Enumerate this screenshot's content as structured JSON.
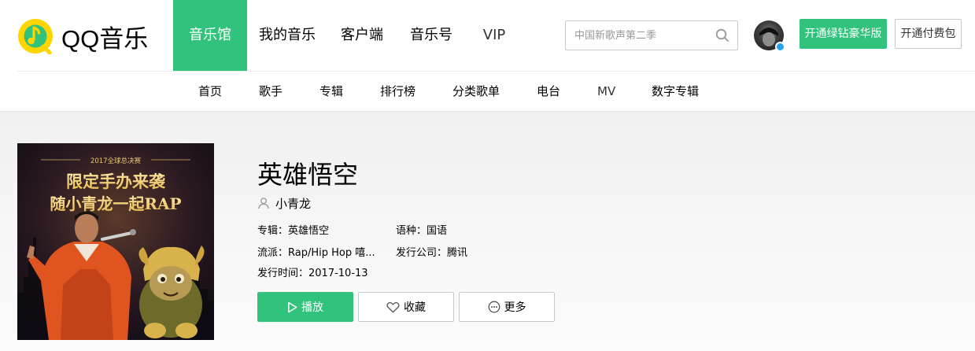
{
  "header": {
    "logo_text": "QQ音乐",
    "nav": [
      {
        "label": "音乐馆",
        "active": true
      },
      {
        "label": "我的音乐",
        "active": false
      },
      {
        "label": "客户端",
        "active": false
      },
      {
        "label": "音乐号",
        "active": false
      },
      {
        "label": "VIP",
        "active": false
      }
    ],
    "search_placeholder": "中国新歌声第二季",
    "green_vip_button": "开通绿钻豪华版",
    "paid_button": "开通付费包"
  },
  "sub_nav": [
    {
      "label": "首页"
    },
    {
      "label": "歌手"
    },
    {
      "label": "专辑"
    },
    {
      "label": "排行榜"
    },
    {
      "label": "分类歌单"
    },
    {
      "label": "电台"
    },
    {
      "label": "MV"
    },
    {
      "label": "数字专辑"
    }
  ],
  "song": {
    "title": "英雄悟空",
    "singer": "小青龙",
    "album": "专辑：英雄悟空",
    "language": "语种：国语",
    "genre": "流派：Rap/Hip Hop 嘻...",
    "publisher": "发行公司：腾讯",
    "release": "发行时间：2017-10-13"
  },
  "cover": {
    "top_text": "2017全球总决赛",
    "line1": "限定手办来袭",
    "line2": "随小青龙一起RAP"
  },
  "actions": {
    "play": "播放",
    "favorite": "收藏",
    "more": "更多"
  },
  "colors": {
    "brand_green": "#31c27c",
    "badge_blue": "#20a3f2"
  }
}
